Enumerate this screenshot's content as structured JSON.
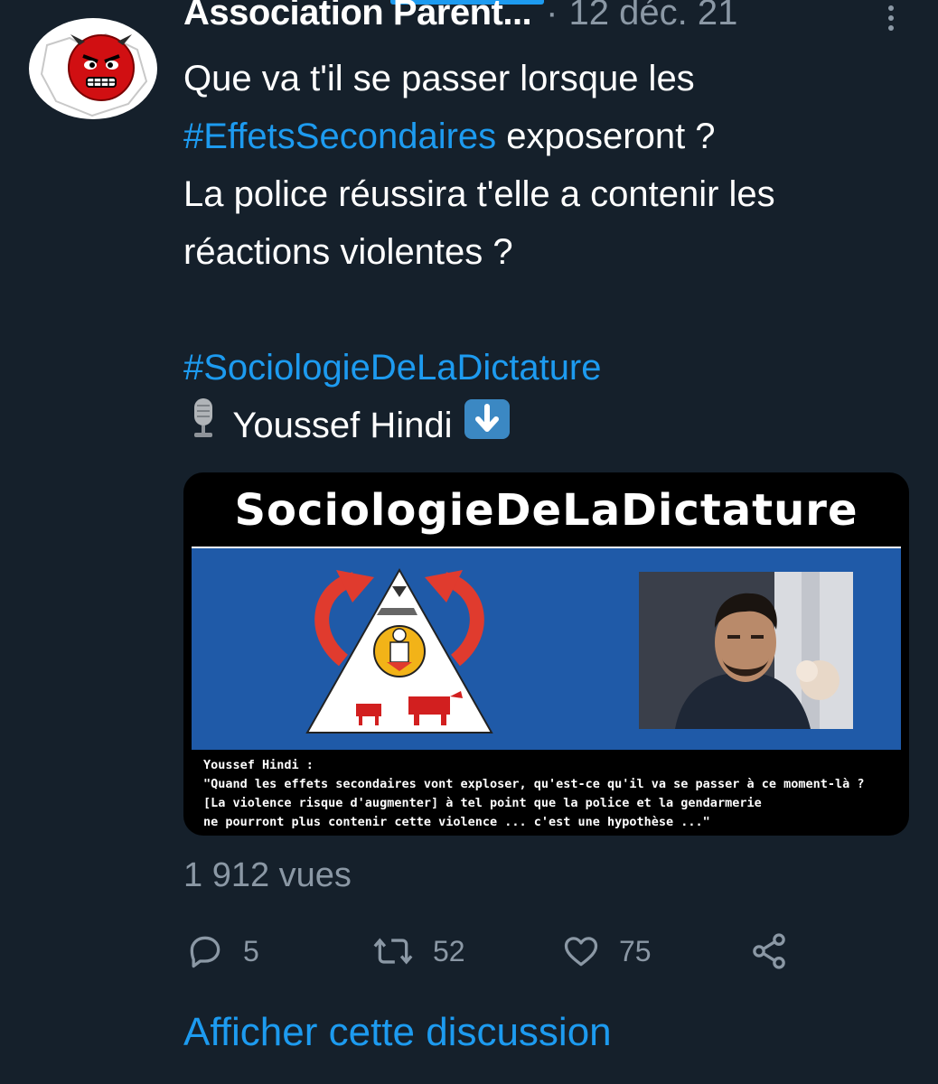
{
  "tweet": {
    "author_name": "Association Parent...",
    "separator": "·",
    "date": "12 déc. 21",
    "text_lines": [
      "Que va t'il se passer lorsque les",
      "exposeront ?",
      "La police réussira t'elle a contenir les",
      "réactions violentes ?"
    ],
    "hashtag_1": "#EffetsSecondaires",
    "hashtag_2": "#SociologieDeLaDictature",
    "mention_line": "Youssef Hindi",
    "media": {
      "title": "SociologieDeLaDictature",
      "caption_lines": [
        "Youssef Hindi :",
        "\"Quand les effets secondaires vont exploser, qu'est-ce qu'il va se passer à ce moment-là ?",
        "[La violence risque d'augmenter] à tel point que la police et la gendarmerie",
        "ne pourront plus contenir cette violence ... c'est une hypothèse ...\""
      ]
    },
    "views": "1 912 vues",
    "actions": {
      "reply_count": "5",
      "retweet_count": "52",
      "like_count": "75"
    },
    "show_thread": "Afficher cette discussion"
  },
  "colors": {
    "background": "#15202b",
    "accent": "#1d9bf0",
    "secondary_text": "#8b98a5"
  },
  "icons": [
    "microphone-icon",
    "down-arrow-icon",
    "more-icon",
    "reply-icon",
    "retweet-icon",
    "like-icon",
    "share-icon"
  ]
}
